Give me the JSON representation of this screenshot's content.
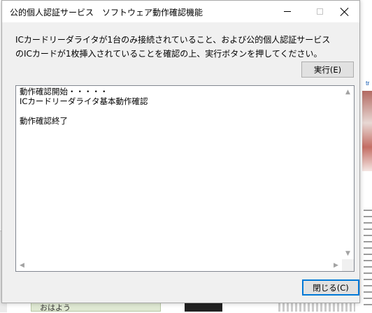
{
  "window": {
    "title": "公的個人認証サービス　ソフトウェア動作確認機能"
  },
  "message": {
    "line1": "ICカードリーダライタが1台のみ接続されていること、および公的個人認証サービス",
    "line2": "のICカードが1枚挿入されていることを確認の上、実行ボタンを押してください。"
  },
  "buttons": {
    "execute_label": "実行(E)",
    "close_label": "閉じる(C)"
  },
  "log": {
    "lines": [
      "動作確認開始・・・・・",
      "ICカードリーダライタ基本動作確認",
      "",
      "動作確認終了"
    ]
  },
  "background": {
    "right_link_text": "tr",
    "bottom_text": "おはよう"
  },
  "colors": {
    "accent": "#0078d7",
    "window_bg": "#f0f0f0",
    "button_bg": "#e1e1e1"
  }
}
